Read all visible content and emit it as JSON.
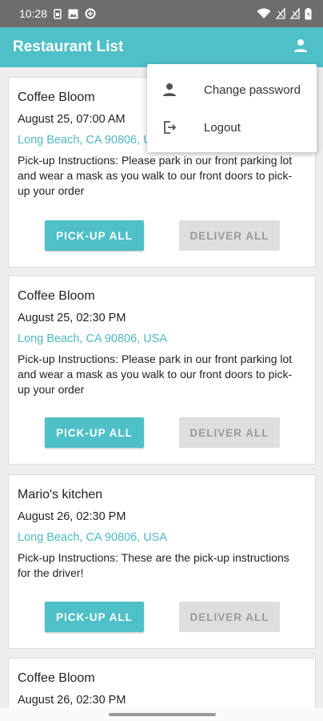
{
  "status_bar": {
    "time": "10:28",
    "icons": [
      "sim-icon",
      "image-icon",
      "data-saver-icon",
      "wifi-icon",
      "signal-icon",
      "signal-icon",
      "battery-icon"
    ]
  },
  "app_bar": {
    "title": "Restaurant List",
    "account_icon": "person-icon"
  },
  "menu": {
    "items": [
      {
        "label": "Change password",
        "icon": "person-icon"
      },
      {
        "label": "Logout",
        "icon": "logout-icon"
      }
    ]
  },
  "restaurants": [
    {
      "name": "Coffee Bloom",
      "date": "August 25, 07:00 AM",
      "address": "Long Beach, CA 90806, USA",
      "instructions": "Pick-up Instructions: Please park in our front parking lot and wear a mask as you walk to our front doors to pick-up your order",
      "pickup_label": "PICK-UP ALL",
      "deliver_label": "DELIVER ALL"
    },
    {
      "name": "Coffee Bloom",
      "date": "August 25, 02:30 PM",
      "address": "Long Beach, CA 90806, USA",
      "instructions": "Pick-up Instructions: Please park in our front parking lot and wear a mask as you walk to our front doors to pick-up your order",
      "pickup_label": "PICK-UP ALL",
      "deliver_label": "DELIVER ALL"
    },
    {
      "name": "Mario's kitchen",
      "date": "August 26, 02:30 PM",
      "address": "Long Beach, CA 90806, USA",
      "instructions": "Pick-up Instructions: These are the pick-up instructions for the driver!",
      "pickup_label": "PICK-UP ALL",
      "deliver_label": "DELIVER ALL"
    },
    {
      "name": "Coffee Bloom",
      "date": "August 26, 02:30 PM"
    }
  ],
  "colors": {
    "accent": "#4fc0c8",
    "address": "#4fb8c2",
    "status_bar": "#6d6d6d",
    "disabled_button": "#dedede"
  }
}
